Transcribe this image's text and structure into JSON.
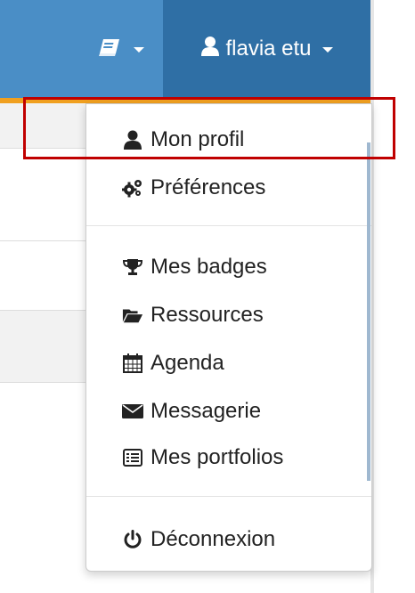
{
  "navbar": {
    "user_label": "flavia etu",
    "accent": "#4a8ec6",
    "user_bg": "#2f6fa5",
    "border_accent": "#f0a020"
  },
  "dropdown": {
    "items": [
      {
        "label": "Mon profil",
        "icon": "user-icon"
      },
      {
        "label": "Préférences",
        "icon": "gears-icon"
      },
      {
        "label": "Mes badges",
        "icon": "trophy-icon"
      },
      {
        "label": "Ressources",
        "icon": "folder-open-icon"
      },
      {
        "label": "Agenda",
        "icon": "calendar-icon"
      },
      {
        "label": "Messagerie",
        "icon": "envelope-icon"
      },
      {
        "label": "Mes portfolios",
        "icon": "list-alt-icon"
      },
      {
        "label": "Déconnexion",
        "icon": "power-icon"
      }
    ]
  },
  "highlight_color": "#c00000"
}
